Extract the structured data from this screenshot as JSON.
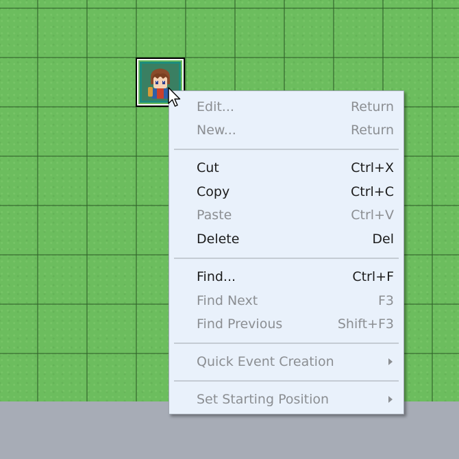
{
  "character": {
    "icon": "character-sprite-icon"
  },
  "context_menu": {
    "items": [
      {
        "label": "Edit...",
        "shortcut": "Return",
        "enabled": false
      },
      {
        "label": "New...",
        "shortcut": "Return",
        "enabled": false
      },
      {
        "label": "Cut",
        "shortcut": "Ctrl+X",
        "enabled": true
      },
      {
        "label": "Copy",
        "shortcut": "Ctrl+C",
        "enabled": true
      },
      {
        "label": "Paste",
        "shortcut": "Ctrl+V",
        "enabled": false
      },
      {
        "label": "Delete",
        "shortcut": "Del",
        "enabled": true
      },
      {
        "label": "Find...",
        "shortcut": "Ctrl+F",
        "enabled": true
      },
      {
        "label": "Find Next",
        "shortcut": "F3",
        "enabled": false
      },
      {
        "label": "Find Previous",
        "shortcut": "Shift+F3",
        "enabled": false
      },
      {
        "label": "Quick Event Creation",
        "submenu": true,
        "enabled": false
      },
      {
        "label": "Set Starting Position",
        "submenu": true,
        "enabled": false
      }
    ]
  },
  "colors": {
    "grass": "#6cbd5e",
    "menu_background": "#e9f1fb",
    "enabled_text": "#1b1b1b",
    "disabled_text": "#8b8e92",
    "empty_area": "#a7acb6"
  }
}
